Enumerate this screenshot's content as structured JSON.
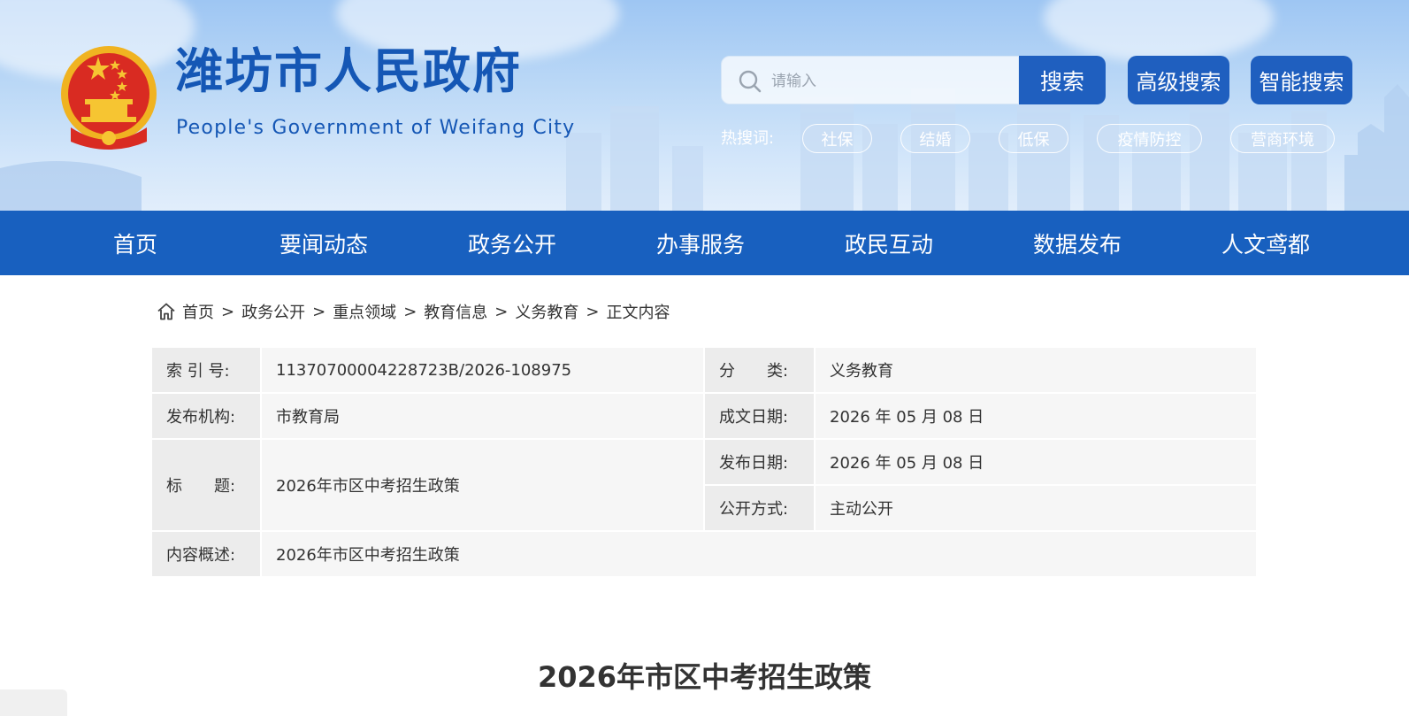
{
  "header": {
    "site_title": "潍坊市人民政府",
    "site_subtitle": "People's Government of Weifang City",
    "emblem_icon": "national-emblem-icon"
  },
  "search": {
    "placeholder": "请输入",
    "search_button": "搜索",
    "advanced_button": "高级搜索",
    "smart_button": "智能搜索",
    "hot_label": "热搜词:",
    "hot_tags": [
      "社保",
      "结婚",
      "低保",
      "疫情防控",
      "营商环境"
    ]
  },
  "nav": {
    "items": [
      "首页",
      "要闻动态",
      "政务公开",
      "办事服务",
      "政民互动",
      "数据发布",
      "人文鸢都"
    ]
  },
  "breadcrumb": {
    "items": [
      "首页",
      "政务公开",
      "重点领域",
      "教育信息",
      "义务教育",
      "正文内容"
    ],
    "separator": ">"
  },
  "info": {
    "index_label": "索 引 号:",
    "index_value": "11370700004228723B/2026-108975",
    "category_label": "分　　类:",
    "category_value": "义务教育",
    "publisher_label": "发布机构:",
    "publisher_value": "市教育局",
    "written_date_label": "成文日期:",
    "written_date_value": "2026 年 05 月 08 日",
    "title_label": "标　　题:",
    "title_value": "2026年市区中考招生政策",
    "publish_date_label": "发布日期:",
    "publish_date_value": "2026 年 05 月 08 日",
    "disclosure_label": "公开方式:",
    "disclosure_value": "主动公开",
    "summary_label": "内容概述:",
    "summary_value": "2026年市区中考招生政策"
  },
  "article": {
    "heading": "2026年市区中考招生政策"
  },
  "colors": {
    "brand_blue": "#1860bf",
    "title_blue": "#1557b5",
    "button_blue": "#1f5fbf"
  }
}
